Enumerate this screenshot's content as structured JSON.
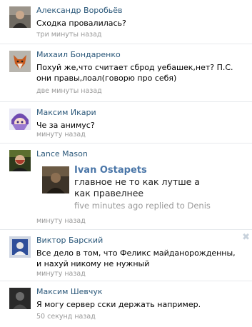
{
  "comments": [
    {
      "author": "Александр Воробьёв",
      "text": "Сходка провалилась?",
      "time": "три минуты назад",
      "avatar_icon": "avatar-photo"
    },
    {
      "author": "Михаил Бондаренко",
      "text": "Похуй же,что считает сброд уебашек,нет? П.С. они правы,лоал(говорю про себя)",
      "time": "две минуты назад",
      "avatar_icon": "fox-avatar"
    },
    {
      "author": "Максим Икари",
      "text": "Че за анимус?",
      "time": "минуту назад",
      "avatar_icon": "anime-avatar"
    },
    {
      "author": "Lance Mason",
      "time": "минуту назад",
      "avatar_icon": "avatar-photo",
      "share": {
        "name": "Ivan Ostapets",
        "text": "главное не то как лутше а как правелнее",
        "meta": "five minutes ago replied to Denis",
        "thumb_icon": "avatar-photo"
      }
    },
    {
      "author": "Виктор Барский",
      "text": "Все дело в том, что Феликс майданорожденны, и нахуй никому не нужный",
      "time": "минуту назад",
      "avatar_icon": "avatar-photo",
      "delete_icon": "close-icon"
    },
    {
      "author": "Максим Шевчук",
      "text": "Я могу сервер сски держать например.",
      "time": "50 секунд назад",
      "avatar_icon": "avatar-photo"
    }
  ],
  "colors": {
    "author": "#2b587a",
    "meta": "#999999",
    "divider": "#e7eaed",
    "share_name": "#4a76a8"
  }
}
